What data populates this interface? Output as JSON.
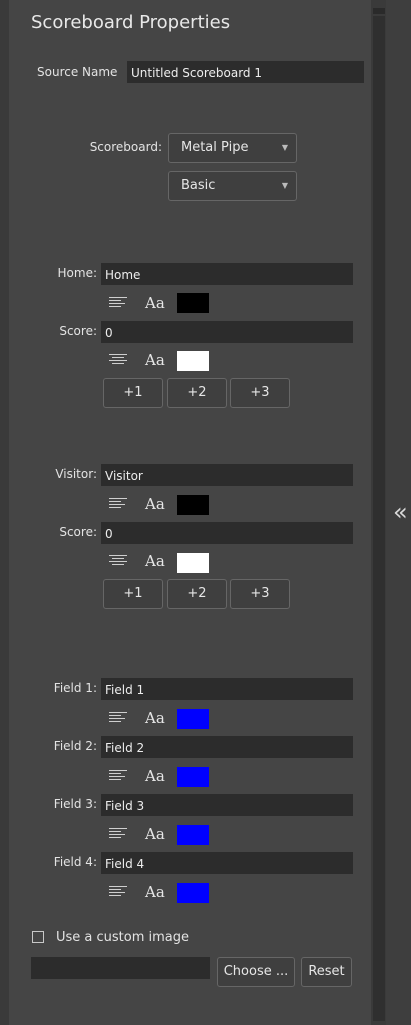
{
  "title": "Scoreboard Properties",
  "source_name": {
    "label": "Source Name",
    "value": "Untitled Scoreboard 1"
  },
  "scoreboard": {
    "label": "Scoreboard:",
    "style": "Metal Pipe",
    "variant": "Basic"
  },
  "home": {
    "label": "Home:",
    "value": "Home",
    "color": "#000000",
    "score_label": "Score:",
    "score": "0",
    "score_color": "#ffffff"
  },
  "visitor": {
    "label": "Visitor:",
    "value": "Visitor",
    "color": "#000000",
    "score_label": "Score:",
    "score": "0",
    "score_color": "#ffffff"
  },
  "increments": [
    "+1",
    "+2",
    "+3"
  ],
  "fields": [
    {
      "label": "Field 1:",
      "value": "Field 1",
      "color": "#0000ff"
    },
    {
      "label": "Field 2:",
      "value": "Field 2",
      "color": "#0000ff"
    },
    {
      "label": "Field 3:",
      "value": "Field 3",
      "color": "#0000ff"
    },
    {
      "label": "Field 4:",
      "value": "Field 4",
      "color": "#0000ff"
    }
  ],
  "font_glyph": "Aa",
  "custom_image": {
    "label": "Use a custom image",
    "checked": false,
    "path": "",
    "choose": "Choose ...",
    "reset": "Reset"
  },
  "collapse_glyph": "«"
}
